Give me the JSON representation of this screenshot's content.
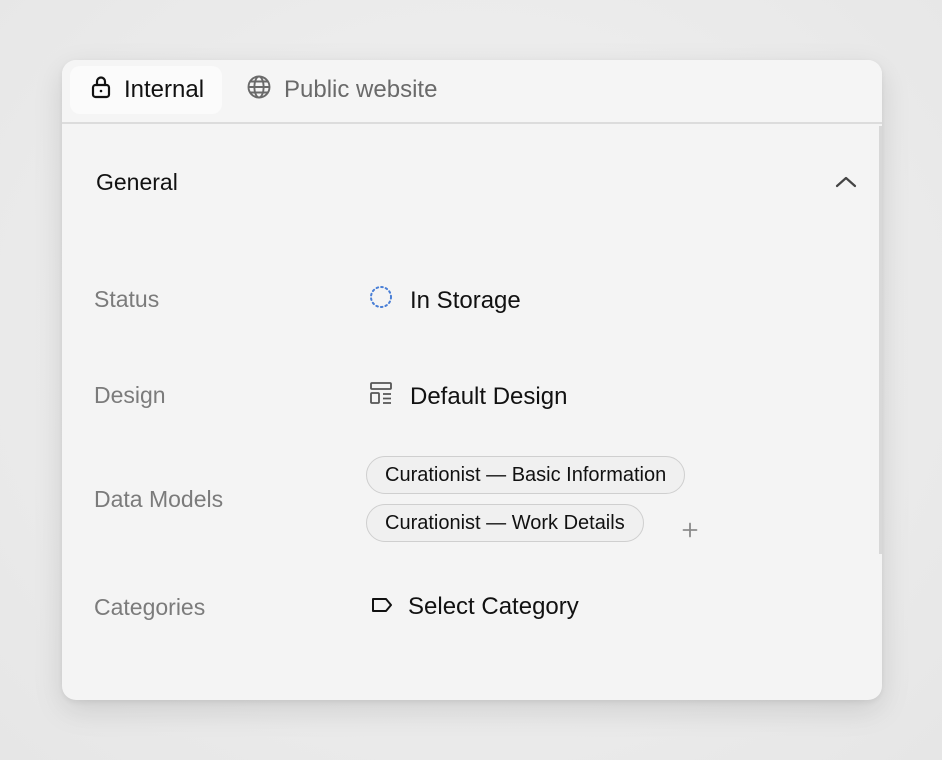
{
  "tabs": [
    {
      "label": "Internal",
      "icon": "lock-icon",
      "active": true
    },
    {
      "label": "Public website",
      "icon": "globe-icon",
      "active": false
    }
  ],
  "section": {
    "title": "General",
    "expanded": true,
    "toggle_icon": "chevron-up-icon"
  },
  "fields": {
    "status": {
      "label": "Status",
      "value": "In Storage",
      "icon": "dotted-circle-icon",
      "icon_color": "#4a7fd6"
    },
    "design": {
      "label": "Design",
      "value": "Default Design",
      "icon": "layout-template-icon"
    },
    "data_models": {
      "label": "Data Models",
      "chips": [
        "Curationist — Basic Information",
        "Curationist — Work Details"
      ],
      "add_icon": "plus-icon"
    },
    "categories": {
      "label": "Categories",
      "value": "Select Category",
      "icon": "tag-icon"
    }
  }
}
